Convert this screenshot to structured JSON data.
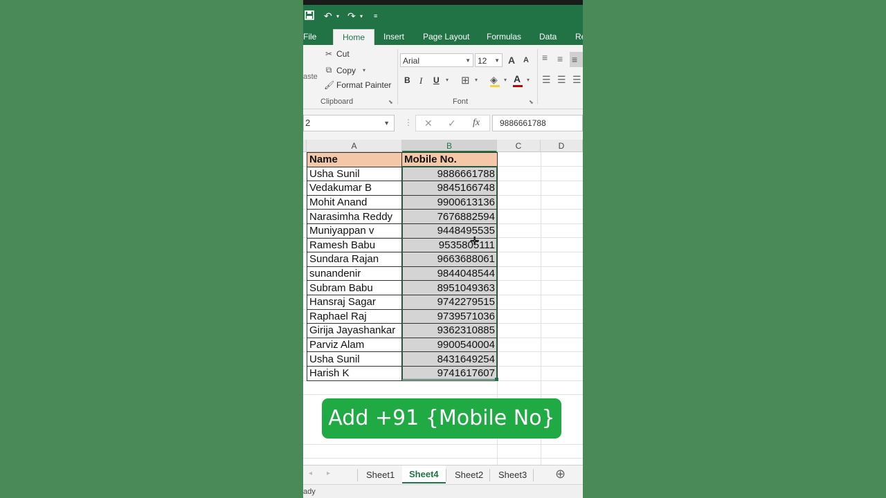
{
  "qat": {
    "save_icon": "save-icon",
    "undo_icon": "undo-icon",
    "redo_icon": "redo-icon"
  },
  "tabs": [
    "File",
    "Home",
    "Insert",
    "Page Layout",
    "Formulas",
    "Data",
    "Re"
  ],
  "clipboard": {
    "paste_partial": "aste",
    "cut": "Cut",
    "copy": "Copy",
    "format_painter": "Format Painter",
    "group_label": "Clipboard"
  },
  "font": {
    "name": "Arial",
    "size": "12",
    "group_label": "Font",
    "bold": "B",
    "italic": "I",
    "underline": "U",
    "grow": "A",
    "shrink": "A",
    "font_color_letter": "A",
    "font_color": "#c00000"
  },
  "formula_bar": {
    "namebox": "2",
    "fx": "fx",
    "value": "9886661788"
  },
  "columns": [
    "A",
    "B",
    "C",
    "D"
  ],
  "table": {
    "headers": [
      "Name",
      "Mobile No."
    ],
    "rows": [
      [
        "Usha Sunil",
        "9886661788"
      ],
      [
        "Vedakumar B",
        "9845166748"
      ],
      [
        "Mohit Anand",
        "9900613136"
      ],
      [
        "Narasimha Reddy",
        "7676882594"
      ],
      [
        "Muniyappan v",
        "9448495535"
      ],
      [
        "Ramesh Babu",
        "9535805111"
      ],
      [
        "Sundara Rajan",
        "9663688061"
      ],
      [
        "sunandenir",
        "9844048544"
      ],
      [
        "Subram Babu",
        "8951049363"
      ],
      [
        "Hansraj Sagar",
        "9742279515"
      ],
      [
        "Raphael Raj",
        "9739571036"
      ],
      [
        "Girija Jayashankar",
        "9362310885"
      ],
      [
        "Parviz Alam",
        "9900540004"
      ],
      [
        "Usha Sunil",
        "8431649254"
      ],
      [
        "Harish K",
        "9741617607"
      ]
    ]
  },
  "banner": "Add +91 {Mobile No}",
  "sheets": [
    "Sheet1",
    "Sheet4",
    "Sheet2",
    "Sheet3"
  ],
  "status": "ady",
  "colors": {
    "excel_green": "#217346",
    "header_fill": "#f4c7a8",
    "banner": "#1faa43"
  }
}
